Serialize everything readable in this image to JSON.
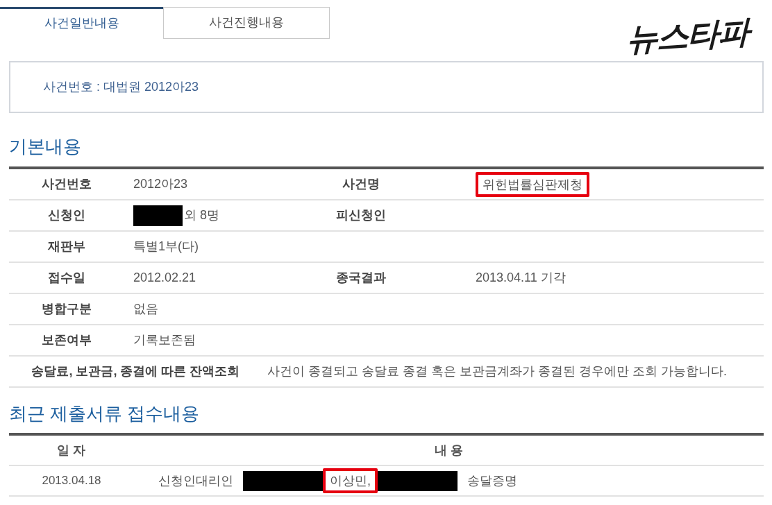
{
  "tabs": [
    {
      "label": "사건일반내용",
      "selected": true
    },
    {
      "label": "사건진행내용",
      "selected": false
    }
  ],
  "logo": {
    "text": "뉴스타파"
  },
  "case_banner": {
    "text": "사건번호 : 대법원 2012아23"
  },
  "basic_info": {
    "title": "기본내용",
    "rows": [
      {
        "kind": "pair",
        "cells": [
          {
            "label": "사건번호",
            "value": [
              {
                "kind": "text",
                "text": "2012아23"
              }
            ]
          },
          {
            "label": "사건명",
            "value": [
              {
                "kind": "highlight",
                "text": "위헌법률심판제청"
              }
            ]
          }
        ]
      },
      {
        "kind": "pair",
        "cells": [
          {
            "label": "신청인",
            "value": [
              {
                "kind": "redaction"
              },
              {
                "kind": "text",
                "text": "외 8명"
              }
            ]
          },
          {
            "label": "피신청인"
          }
        ]
      },
      {
        "kind": "pair",
        "cells": [
          {
            "label": "재판부",
            "value": [
              {
                "kind": "text",
                "text": "특별1부(다)"
              }
            ]
          }
        ]
      },
      {
        "kind": "pair",
        "cells": [
          {
            "label": "접수일",
            "value": [
              {
                "kind": "text",
                "text": "2012.02.21"
              }
            ]
          },
          {
            "label": "종국결과",
            "value": [
              {
                "kind": "text",
                "text": "2013.04.11 기각"
              }
            ]
          }
        ]
      },
      {
        "kind": "pair",
        "cells": [
          {
            "label": "병합구분",
            "value": [
              {
                "kind": "text",
                "text": "없음"
              }
            ]
          }
        ]
      },
      {
        "kind": "pair",
        "cells": [
          {
            "label": "보존여부",
            "value": [
              {
                "kind": "text",
                "text": "기록보존됨"
              }
            ]
          }
        ]
      },
      {
        "kind": "wide",
        "cells": [
          {
            "label": "송달료, 보관금, 종결에 따른 잔액조회",
            "value": [
              {
                "kind": "text",
                "text": "사건이 종결되고 송달료 종결 혹은 보관금계좌가 종결된 경우에만 조회 가능합니다."
              }
            ]
          }
        ]
      }
    ]
  },
  "recent_documents": {
    "title": "최근 제출서류 접수내용",
    "columns": [
      "일 자",
      "내 용"
    ],
    "rows": [
      {
        "date": "2013.04.18",
        "content": [
          {
            "kind": "text",
            "text": "신청인대리인"
          },
          {
            "kind": "redaction"
          },
          {
            "kind": "highlight",
            "text": "이상민,"
          },
          {
            "kind": "redaction"
          },
          {
            "kind": "text",
            "text": "송달증명"
          }
        ]
      }
    ]
  }
}
